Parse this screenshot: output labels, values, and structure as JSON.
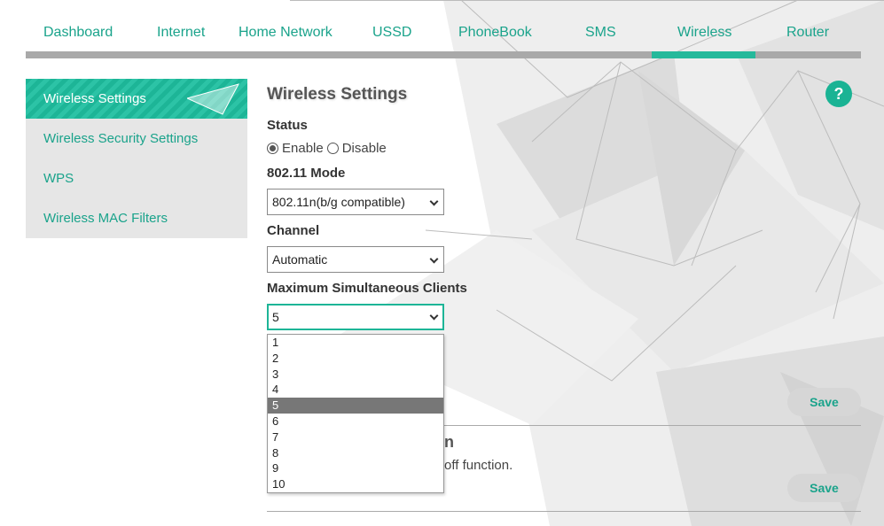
{
  "nav": {
    "items": [
      "Dashboard",
      "Internet",
      "Home Network",
      "USSD",
      "PhoneBook",
      "SMS",
      "Wireless",
      "Router"
    ],
    "active": "Wireless"
  },
  "sidebar": {
    "items": [
      {
        "label": "Wireless Settings",
        "active": true
      },
      {
        "label": "Wireless Security Settings",
        "active": false
      },
      {
        "label": "WPS",
        "active": false
      },
      {
        "label": "Wireless MAC Filters",
        "active": false
      }
    ]
  },
  "main": {
    "title": "Wireless Settings",
    "help_label": "?",
    "status": {
      "label": "Status",
      "enable": "Enable",
      "disable": "Disable",
      "selected": "Enable"
    },
    "mode": {
      "label": "802.11 Mode",
      "value": "802.11n(b/g compatible)"
    },
    "channel": {
      "label": "Channel",
      "value": "Automatic"
    },
    "max_clients": {
      "label": "Maximum Simultaneous Clients",
      "value": "5",
      "options": [
        "1",
        "2",
        "3",
        "4",
        "5",
        "6",
        "7",
        "8",
        "9",
        "10"
      ]
    },
    "save_label": "Save",
    "section2": {
      "title_visible": "n",
      "desc_visible": "off function.",
      "save_label": "Save"
    }
  },
  "colors": {
    "accent": "#1aa38b",
    "nav_bar": "#a9a9a9",
    "nav_active": "#25b99b",
    "sidebar_bg": "#e6e6e6"
  }
}
